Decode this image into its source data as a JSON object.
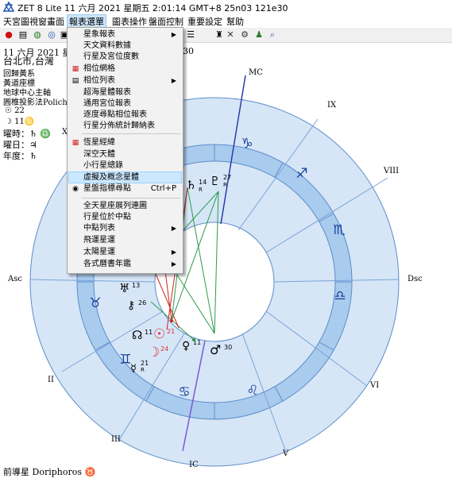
{
  "window": {
    "title": "ZET 8 Lite   11 六月 2021  星期五   2:01:14 GMT+8 25n03  121e30"
  },
  "menubar": {
    "items": [
      "天宮圖",
      "視窗畫面",
      "報表選單",
      "圖表操作",
      "盤面控制",
      "重要設定",
      "幫助"
    ],
    "active_index": 2
  },
  "toolbar": {
    "icons": [
      "stop-icon",
      "list-icon",
      "globe-icon",
      "target-icon",
      "clipboard-icon",
      "settings-icon",
      "person-icon",
      "tools-icon",
      "search-icon"
    ]
  },
  "info_panel": {
    "date_line": "11 六月 2021  星期",
    "date_trail": "30",
    "place": "台北市,台灣",
    "lines": [
      "回歸黃系",
      "黃道座標",
      "地球中心主軸",
      "圓椎投影法Polich-P"
    ],
    "sun": "☉  22",
    "moon": "☽  11♋",
    "day_ruler": "曜時：♄ ♎",
    "day_ruler_extra": "X",
    "day_lord": "曜日：♃",
    "year_lord": "年度：♄",
    "footer": "前導星 Doriphoros  ♉"
  },
  "chart_labels": {
    "mc": "MC",
    "ic": "IC",
    "asc": "Asc",
    "dsc": "Dsc",
    "houses": [
      "II",
      "III",
      "V",
      "VI",
      "VIII",
      "IX"
    ]
  },
  "zodiac": [
    "♑",
    "♐",
    "♏",
    "♎",
    "♌",
    "♋",
    "♊",
    "♉"
  ],
  "planets": [
    {
      "glyph": "♄",
      "degree": "14",
      "extra": "R"
    },
    {
      "glyph": "♇",
      "degree": "27",
      "extra": "R"
    },
    {
      "glyph": "♅",
      "degree": "13",
      "extra": ""
    },
    {
      "glyph": "⚷",
      "degree": "26",
      "extra": ""
    },
    {
      "glyph": "☊",
      "degree": "11",
      "extra": ""
    },
    {
      "glyph": "☉",
      "degree": "21",
      "extra": ""
    },
    {
      "glyph": "☽",
      "degree": "24",
      "extra": ""
    },
    {
      "glyph": "♀",
      "degree": "11",
      "extra": ""
    },
    {
      "glyph": "♂",
      "degree": "30",
      "extra": ""
    },
    {
      "glyph": "☿",
      "degree": "21",
      "extra": "R"
    }
  ],
  "colors": {
    "chart_fill": "#d6e6f7",
    "ring_fill": "#a9cbee",
    "chart_line": "#5b8cc9",
    "mc_line": "#2b3fa8",
    "sun_red": "#e03030",
    "aspect_green": "#2d9a4a",
    "aspect_red": "#d02020",
    "menu_highlight": "#cce8ff"
  },
  "report_menu": {
    "items": [
      {
        "label": "星象報表",
        "submenu": true,
        "icon": ""
      },
      {
        "label": "天文資料數據",
        "submenu": false,
        "icon": ""
      },
      {
        "label": "行星及宮位度數",
        "submenu": false,
        "icon": ""
      },
      {
        "label": "相位網格",
        "submenu": false,
        "icon": "grid"
      },
      {
        "label": "相位列表",
        "submenu": true,
        "icon": "list"
      },
      {
        "label": "超海星體報表",
        "submenu": false,
        "icon": ""
      },
      {
        "label": "通用宮位報表",
        "submenu": false,
        "icon": ""
      },
      {
        "label": "逐度尋點相位報表",
        "submenu": false,
        "icon": ""
      },
      {
        "label": "行星分佈統計歸納表",
        "submenu": false,
        "icon": ""
      },
      {
        "label": "恆星經緯",
        "submenu": false,
        "icon": "star"
      },
      {
        "label": "深空天體",
        "submenu": false,
        "icon": ""
      },
      {
        "label": "小行星總錄",
        "submenu": false,
        "icon": ""
      },
      {
        "label": "虛擬及概念星體",
        "submenu": false,
        "icon": "",
        "highlighted": true
      },
      {
        "label": "星盤指標尋點",
        "submenu": false,
        "icon": "target",
        "shortcut": "Ctrl+P"
      },
      {
        "label": "全天星座展列連圖",
        "submenu": false,
        "icon": ""
      },
      {
        "label": "行星位於中點",
        "submenu": false,
        "icon": ""
      },
      {
        "label": "中點列表",
        "submenu": true,
        "icon": ""
      },
      {
        "label": "飛運星運",
        "submenu": false,
        "icon": ""
      },
      {
        "label": "太陽星運",
        "submenu": true,
        "icon": ""
      },
      {
        "label": "各式曆書年鑑",
        "submenu": true,
        "icon": ""
      }
    ]
  }
}
